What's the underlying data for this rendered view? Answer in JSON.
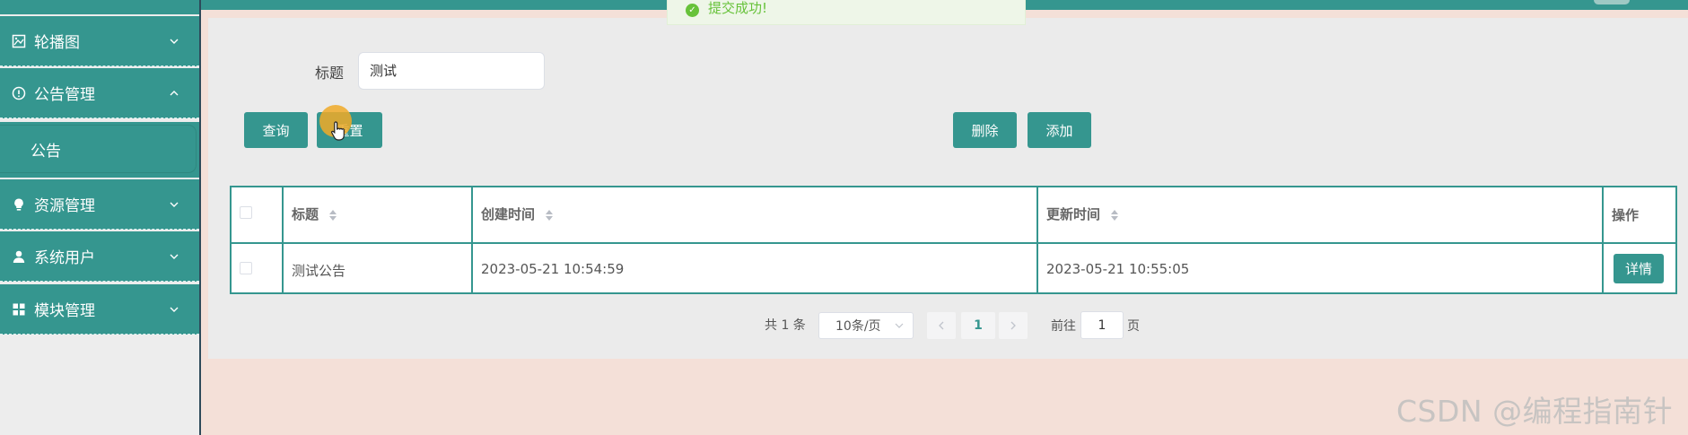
{
  "toast": {
    "message": "提交成功!"
  },
  "sidebar": {
    "items": [
      {
        "label": "轮播图",
        "icon": "image-icon"
      },
      {
        "label": "公告管理",
        "icon": "info-circle-icon"
      },
      {
        "label": "资源管理",
        "icon": "bulb-icon"
      },
      {
        "label": "系统用户",
        "icon": "user-icon"
      },
      {
        "label": "模块管理",
        "icon": "grid-icon"
      }
    ],
    "sub_item": "公告"
  },
  "search": {
    "label": "标题",
    "value": "测试"
  },
  "buttons": {
    "query": "查询",
    "reset": "重置",
    "delete": "删除",
    "add": "添加",
    "detail": "详情"
  },
  "table": {
    "headers": [
      "标题",
      "创建时间",
      "更新时间",
      "操作"
    ],
    "rows": [
      {
        "title": "测试公告",
        "created": "2023-05-21 10:54:59",
        "updated": "2023-05-21 10:55:05"
      }
    ]
  },
  "pagination": {
    "total": "共 1 条",
    "page_size": "10条/页",
    "current": "1",
    "goto_label": "前往",
    "goto_value": "1",
    "page_label": "页"
  },
  "watermark": "CSDN @编程指南针",
  "colors": {
    "primary": "#35968f",
    "success": "#67c23a"
  }
}
